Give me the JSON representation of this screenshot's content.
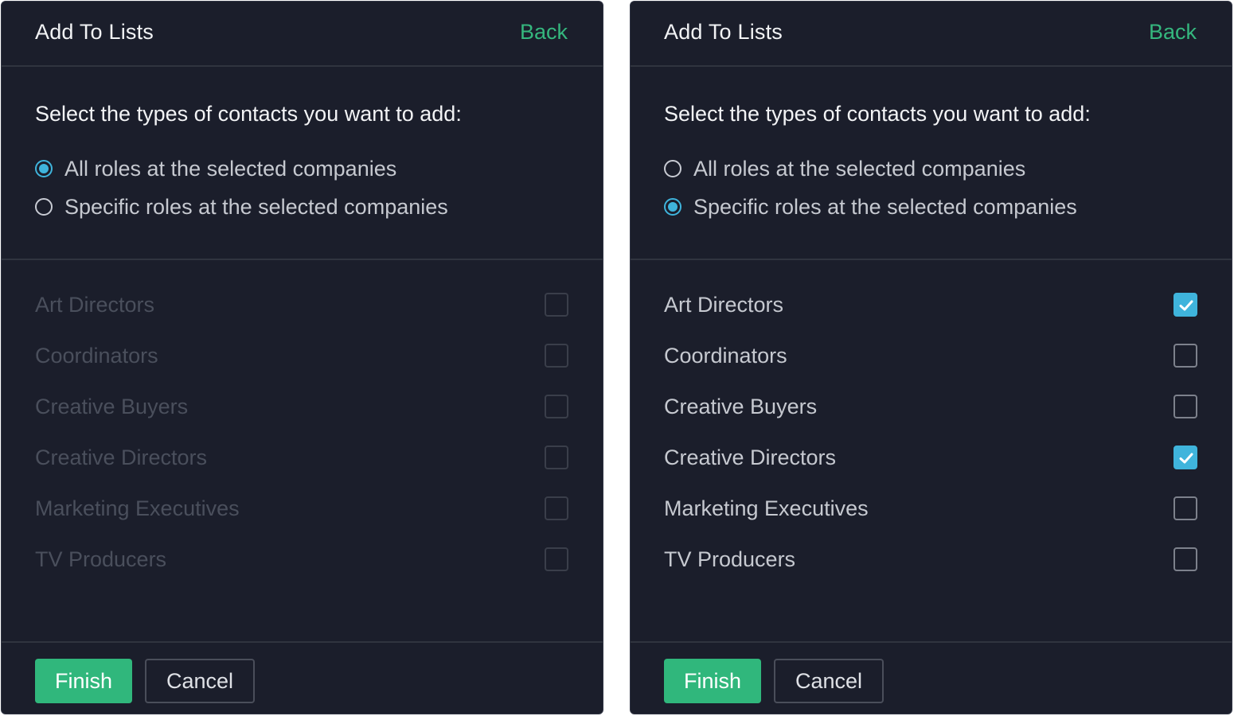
{
  "colors": {
    "panel_bg": "#1b1e2b",
    "accent_green": "#35b77e",
    "accent_blue": "#3fb4dc"
  },
  "panels": [
    {
      "title": "Add To Lists",
      "back_label": "Back",
      "prompt": "Select the types of contacts you want to add:",
      "radio_options": [
        {
          "label": "All roles at the selected companies",
          "selected": true
        },
        {
          "label": "Specific roles at the selected companies",
          "selected": false
        }
      ],
      "roles_enabled": false,
      "roles": [
        {
          "label": "Art Directors",
          "checked": false
        },
        {
          "label": "Coordinators",
          "checked": false
        },
        {
          "label": "Creative Buyers",
          "checked": false
        },
        {
          "label": "Creative Directors",
          "checked": false
        },
        {
          "label": "Marketing Executives",
          "checked": false
        },
        {
          "label": "TV Producers",
          "checked": false
        }
      ],
      "finish_label": "Finish",
      "cancel_label": "Cancel"
    },
    {
      "title": "Add To Lists",
      "back_label": "Back",
      "prompt": "Select the types of contacts you want to add:",
      "radio_options": [
        {
          "label": "All roles at the selected companies",
          "selected": false
        },
        {
          "label": "Specific roles at the selected companies",
          "selected": true
        }
      ],
      "roles_enabled": true,
      "roles": [
        {
          "label": "Art Directors",
          "checked": true
        },
        {
          "label": "Coordinators",
          "checked": false
        },
        {
          "label": "Creative Buyers",
          "checked": false
        },
        {
          "label": "Creative Directors",
          "checked": true
        },
        {
          "label": "Marketing Executives",
          "checked": false
        },
        {
          "label": "TV Producers",
          "checked": false
        }
      ],
      "finish_label": "Finish",
      "cancel_label": "Cancel"
    }
  ]
}
